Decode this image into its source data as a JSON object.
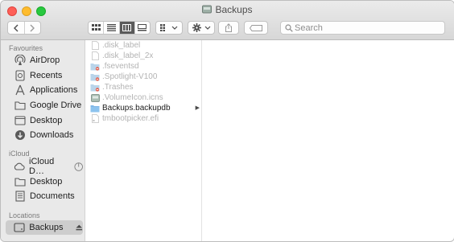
{
  "window": {
    "title": "Backups"
  },
  "toolbar": {
    "back_icon": "chevron-left-icon",
    "forward_icon": "chevron-right-icon",
    "views": [
      "icon-view",
      "list-view",
      "column-view",
      "gallery-view"
    ],
    "active_view": "column-view",
    "search_placeholder": "Search"
  },
  "sidebar": {
    "favourites_label": "Favourites",
    "favourites": [
      {
        "label": "AirDrop",
        "icon": "airdrop-icon"
      },
      {
        "label": "Recents",
        "icon": "recents-icon"
      },
      {
        "label": "Applications",
        "icon": "applications-icon"
      },
      {
        "label": "Google Drive",
        "icon": "folder-icon"
      },
      {
        "label": "Desktop",
        "icon": "desktop-icon"
      },
      {
        "label": "Downloads",
        "icon": "downloads-icon"
      }
    ],
    "icloud_label": "iCloud",
    "icloud": [
      {
        "label": "iCloud D…",
        "icon": "cloud-icon"
      },
      {
        "label": "Desktop",
        "icon": "folder-icon"
      },
      {
        "label": "Documents",
        "icon": "documents-icon"
      }
    ],
    "locations_label": "Locations",
    "locations": [
      {
        "label": "Backups",
        "icon": "disk-icon",
        "selected": true
      }
    ]
  },
  "column1": {
    "items": [
      {
        "name": ".disk_label",
        "icon": "document-icon",
        "dimmed": true
      },
      {
        "name": ".disk_label_2x",
        "icon": "document-icon",
        "dimmed": true
      },
      {
        "name": ".fseventsd",
        "icon": "restricted-folder-icon",
        "dimmed": true
      },
      {
        "name": ".Spotlight-V100",
        "icon": "restricted-folder-icon",
        "dimmed": true
      },
      {
        "name": ".Trashes",
        "icon": "restricted-folder-icon",
        "dimmed": true
      },
      {
        "name": ".VolumeIcon.icns",
        "icon": "disk-image-icon",
        "dimmed": true
      },
      {
        "name": "Backups.backupdb",
        "icon": "folder-icon",
        "dimmed": false,
        "has_children": true
      },
      {
        "name": "tmbootpicker.efi",
        "icon": "document-icon",
        "dimmed": true
      }
    ]
  }
}
